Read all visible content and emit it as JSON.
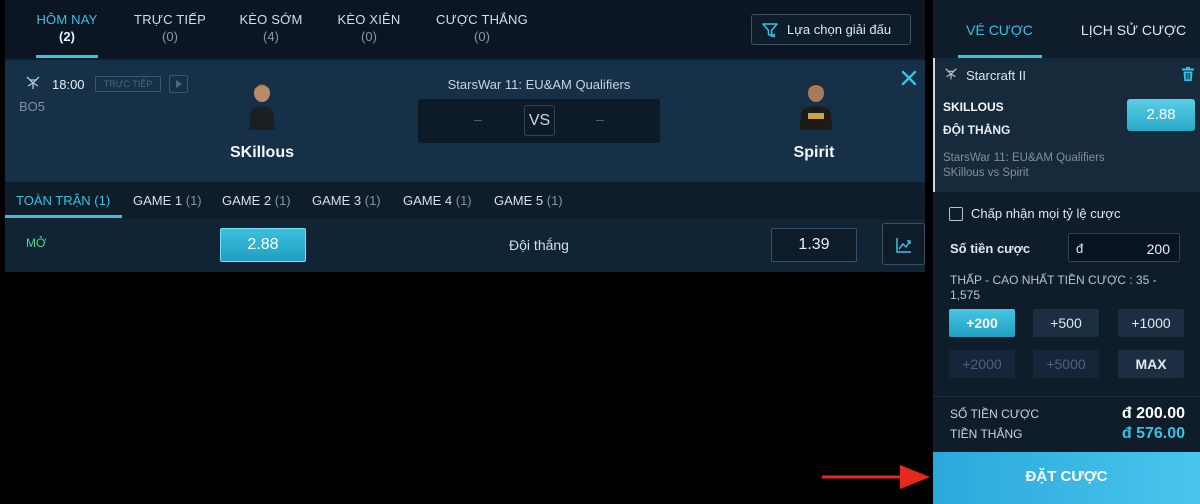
{
  "main_tabs": [
    {
      "label": "HÔM NAY",
      "count": "(2)"
    },
    {
      "label": "TRỰC TIẾP",
      "count": "(0)"
    },
    {
      "label": "KÈO SỚM",
      "count": "(4)"
    },
    {
      "label": "KÈO XIÊN",
      "count": "(0)"
    },
    {
      "label": "CƯỢC THẮNG",
      "count": "(0)"
    }
  ],
  "filter": {
    "label": "Lựa chọn giải đấu"
  },
  "match": {
    "time": "18:00",
    "live_badge": "TRỰC TIẾP",
    "format": "BO5",
    "tournament": "StarsWar 11: EU&AM Qualifiers",
    "score_left": "–",
    "score_right": "–",
    "vs": "VS",
    "team_home": "SKillous",
    "team_away": "Spirit"
  },
  "sub_tabs": [
    {
      "label": "TOÀN TRẬN",
      "count": "(1)"
    },
    {
      "label": "GAME 1",
      "count": "(1)"
    },
    {
      "label": "GAME 2",
      "count": "(1)"
    },
    {
      "label": "GAME 3",
      "count": "(1)"
    },
    {
      "label": "GAME 4",
      "count": "(1)"
    },
    {
      "label": "GAME 5",
      "count": "(1)"
    }
  ],
  "market": {
    "status": "MỞ",
    "name": "Đội thắng",
    "odd_home": "2.88",
    "odd_away": "1.39"
  },
  "right_panel": {
    "tab_ticket": "VÉ CƯỢC",
    "tab_history": "LỊCH SỬ CƯỢC",
    "ticket": {
      "game": "Starcraft II",
      "pick": "SKILLOUS",
      "market": "ĐỘI THẮNG",
      "odd": "2.88",
      "tournament": "StarsWar 11: EU&AM Qualifiers",
      "matchup": "SKillous vs Spirit"
    },
    "accept_any_odds": "Chấp nhận mọi tỷ lệ cược",
    "stake_label": "Số tiền cược",
    "stake_currency": "đ",
    "stake_value": "200",
    "limits": "THẤP - CAO NHẤT TIỀN CƯỢC : 35 - 1,575",
    "chips": [
      "+200",
      "+500",
      "+1000",
      "+2000",
      "+5000",
      "MAX"
    ],
    "total_stake_label": "SỐ TIỀN CƯỢC",
    "total_stake_value": "đ 200.00",
    "payout_label": "TIỀN THẮNG",
    "payout_value": "đ 576.00",
    "place_bet": "ĐẶT CƯỢC"
  },
  "colors": {
    "accent": "#35c2e4",
    "open_status": "#3ddf8d",
    "annotation_arrow": "#e5291d"
  }
}
